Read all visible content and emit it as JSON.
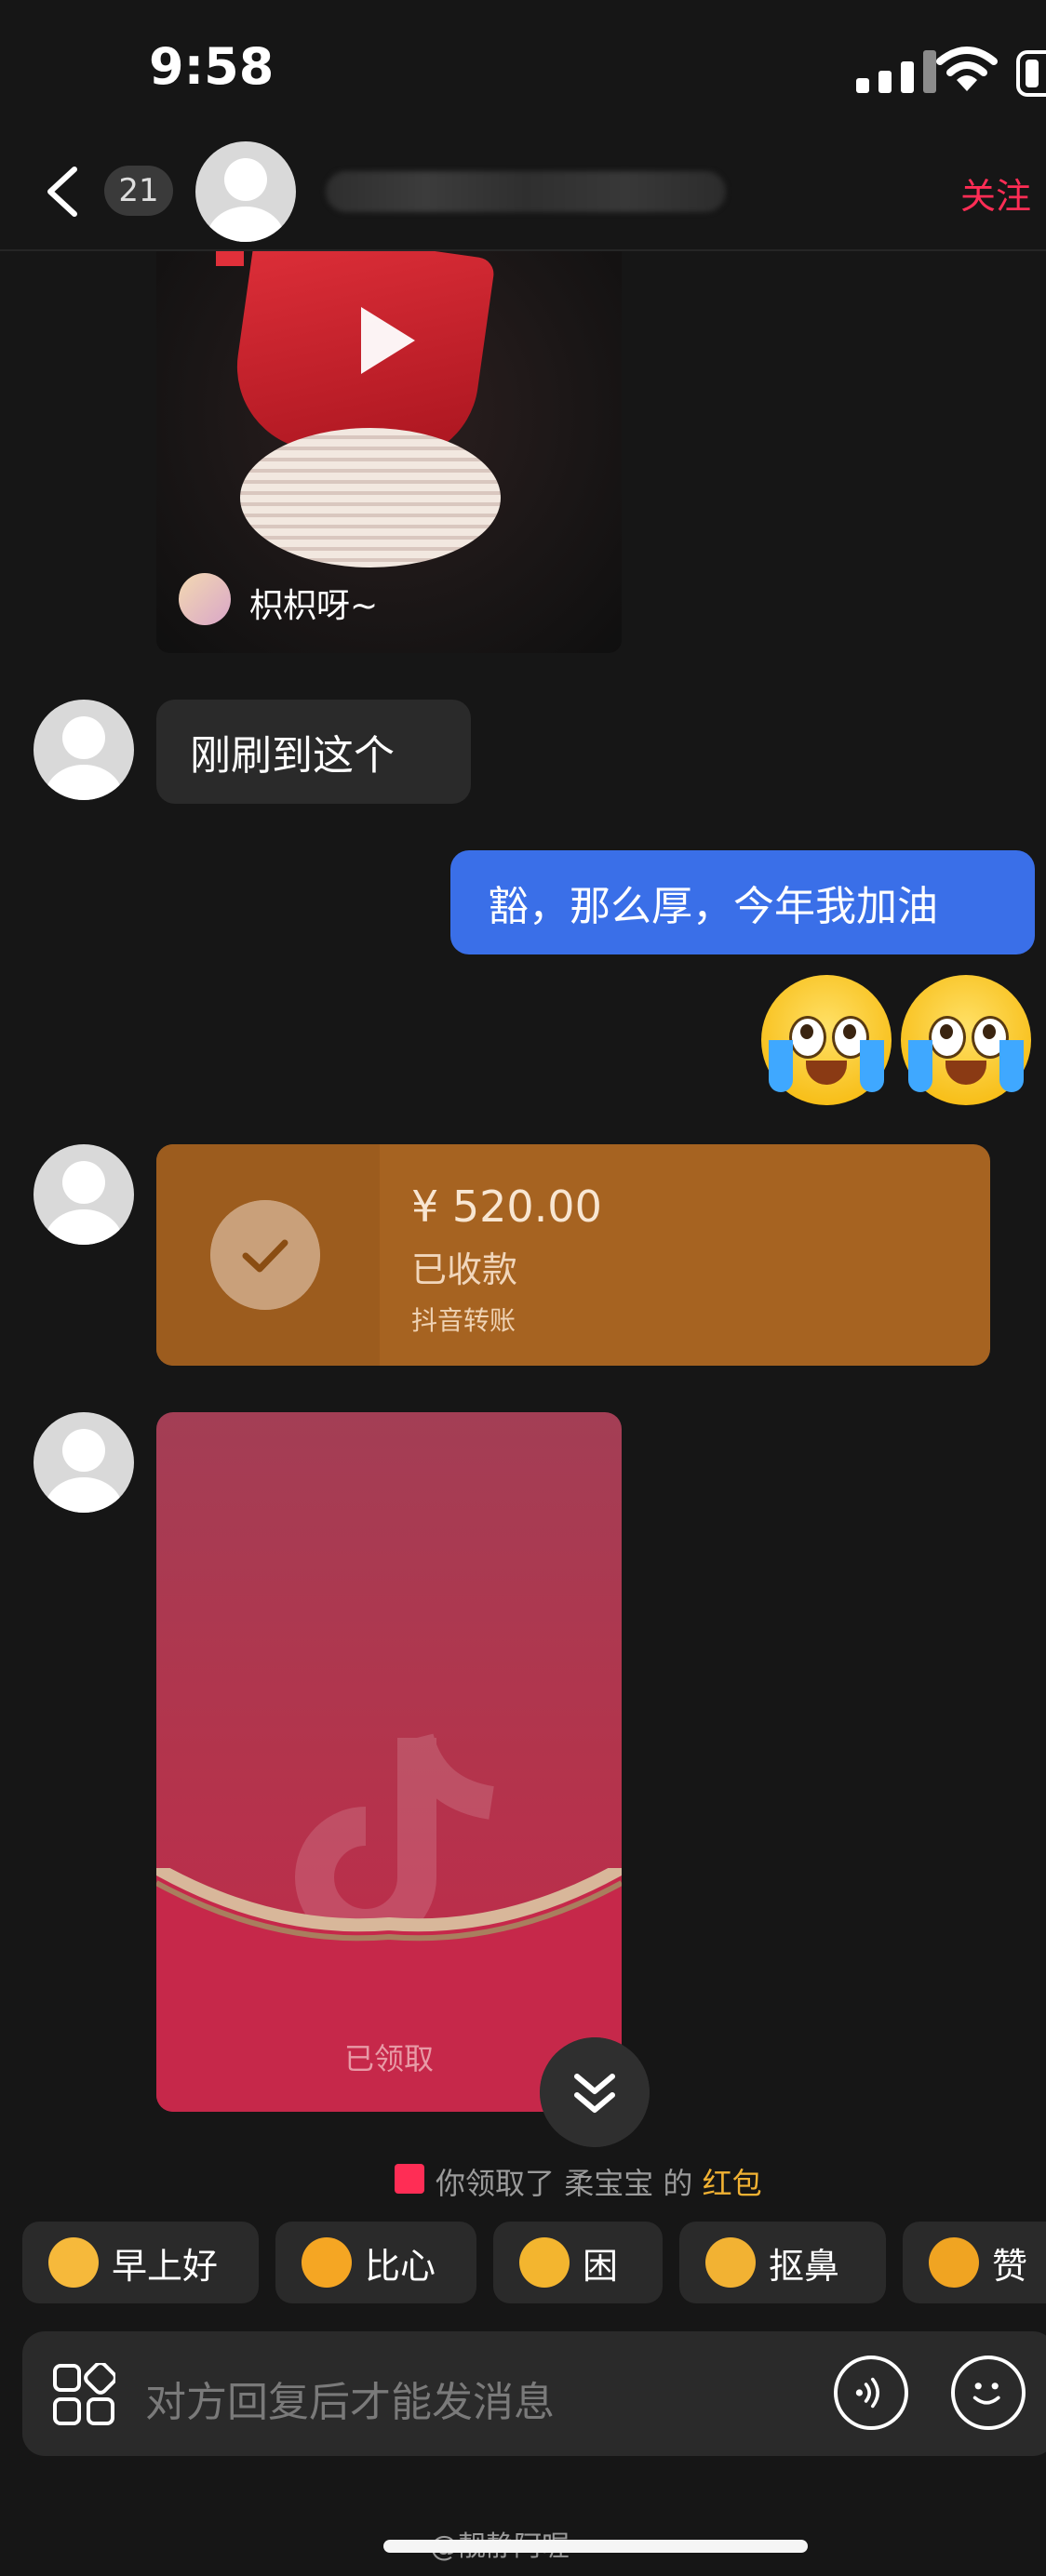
{
  "status_bar": {
    "time": "9:58"
  },
  "header": {
    "back_icon": "chevron-left-icon",
    "unread_count": "21",
    "follow_label": "关注"
  },
  "video_card": {
    "author": "枳枳呀~"
  },
  "messages": {
    "incoming_1": "刚刷到这个",
    "outgoing_1": "豁，那么厚，今年我加油"
  },
  "transfer": {
    "amount": "¥ 520.00",
    "status": "已收款",
    "source": "抖音转账"
  },
  "red_envelope": {
    "status": "已领取"
  },
  "notice": {
    "prefix": "你领取了",
    "name": "柔宝宝",
    "mid": "的",
    "link": "红包"
  },
  "quick_replies": [
    {
      "label": "早上好",
      "icon": "sun-emoji-icon",
      "color": "#f6b93b"
    },
    {
      "label": "比心",
      "icon": "heart-hand-emoji-icon",
      "color": "#f5a623"
    },
    {
      "label": "困",
      "icon": "sleepy-emoji-icon",
      "color": "#f3b52f"
    },
    {
      "label": "抠鼻",
      "icon": "nose-pick-emoji-icon",
      "color": "#f2b233"
    },
    {
      "label": "赞",
      "icon": "thumbs-up-emoji-icon",
      "color": "#f0a422"
    }
  ],
  "input": {
    "placeholder": "对方回复后才能发消息"
  },
  "watermark": "@靓静阿喔",
  "colors": {
    "bubble_out": "#3a6fe8",
    "transfer": "#a66321",
    "envelope": "#b3344c",
    "accent": "#ff2d55"
  }
}
